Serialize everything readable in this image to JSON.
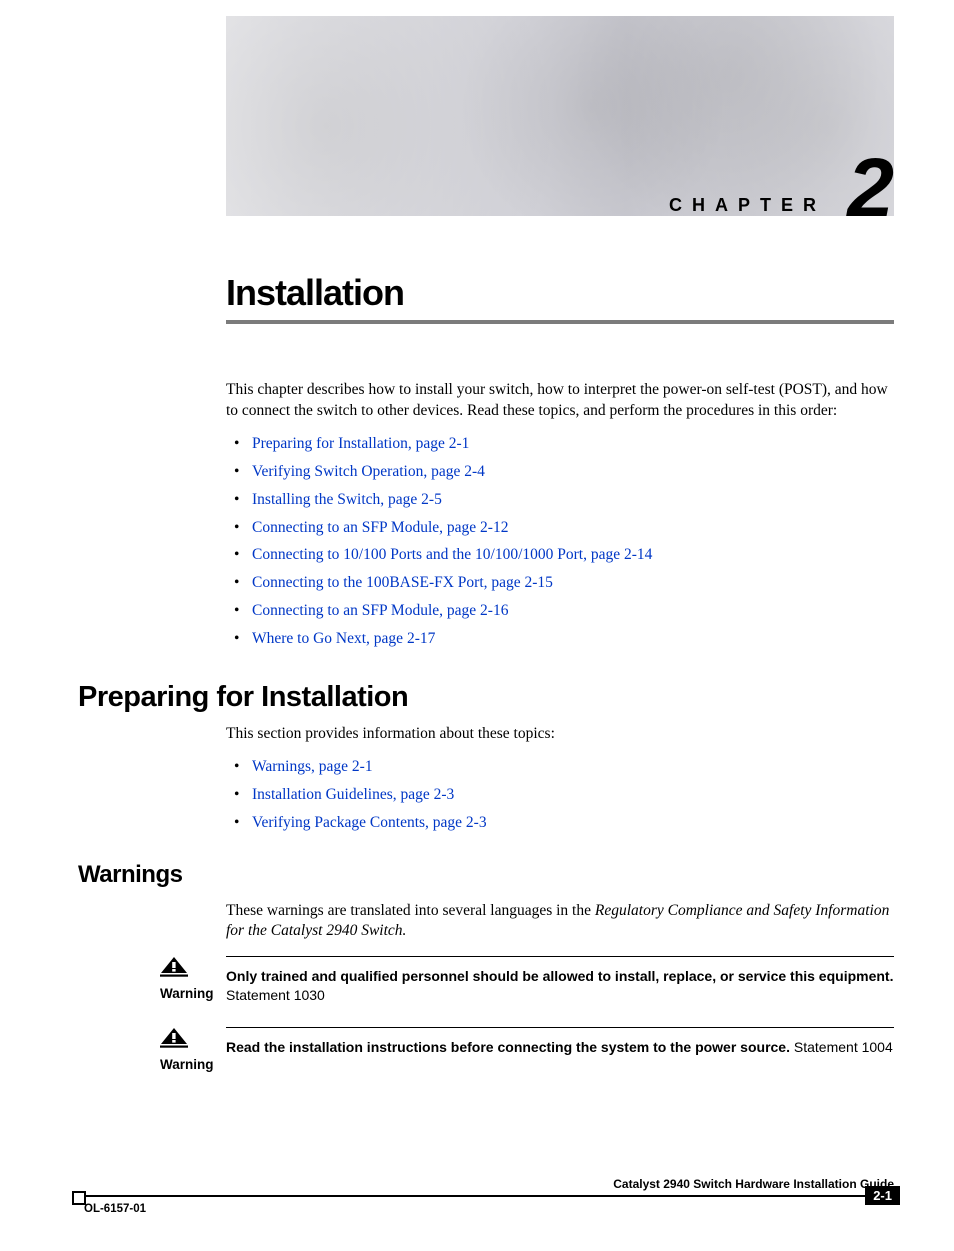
{
  "banner": {
    "chapter_label": "CHAPTER",
    "chapter_number": "2"
  },
  "title": "Installation",
  "intro": "This chapter describes how to install your switch, how to interpret the power-on self-test (POST), and how to connect the switch to other devices. Read these topics, and perform the procedures in this order:",
  "toc": [
    "Preparing for Installation, page 2-1",
    "Verifying Switch Operation, page 2-4",
    "Installing the Switch, page 2-5",
    "Connecting to an SFP Module, page 2-12",
    "Connecting to 10/100 Ports and the 10/100/1000 Port, page 2-14",
    "Connecting to the 100BASE-FX Port, page 2-15",
    "Connecting to an SFP Module, page 2-16",
    "Where to Go Next, page 2-17"
  ],
  "section_preparing": {
    "heading": "Preparing for Installation",
    "intro": "This section provides information about these topics:",
    "links": [
      "Warnings, page 2-1",
      "Installation Guidelines, page 2-3",
      "Verifying Package Contents, page 2-3"
    ]
  },
  "section_warnings": {
    "heading": "Warnings",
    "intro_pre": "These warnings are translated into several languages in the ",
    "intro_ital": "Regulatory Compliance and Safety Information for the Catalyst 2940 Switch.",
    "label": "Warning",
    "items": [
      {
        "bold": "Only trained and qualified personnel should be allowed to install, replace, or service this equipment.",
        "norm": " Statement 1030"
      },
      {
        "bold": "Read the installation instructions before connecting the system to the power source.",
        "norm": " Statement 1004"
      }
    ]
  },
  "footer": {
    "guide": "Catalyst 2940 Switch Hardware Installation Guide",
    "page": "2-1",
    "doc_id": "OL-6157-01"
  }
}
